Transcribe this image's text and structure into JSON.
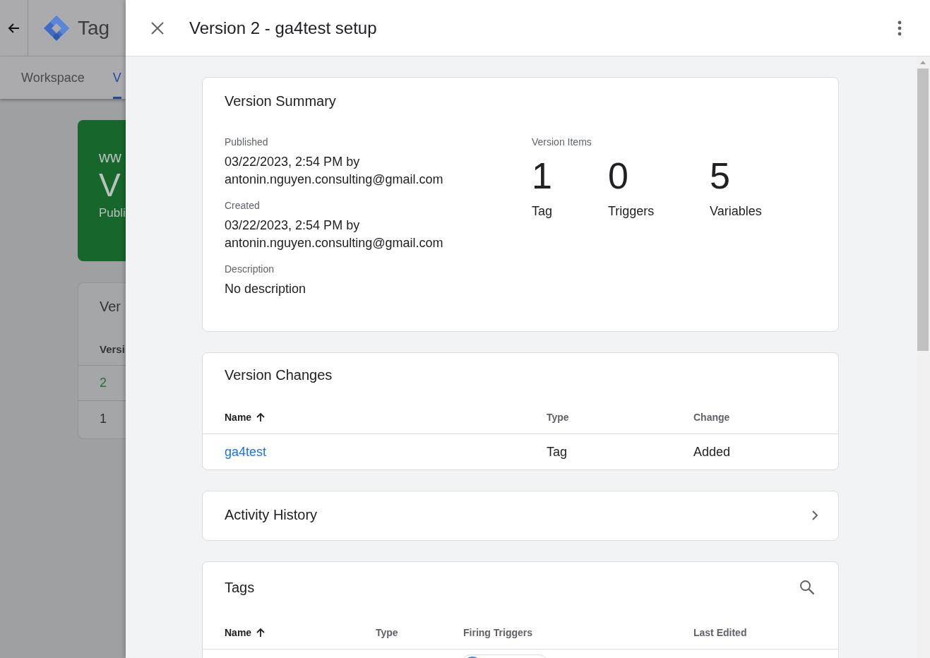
{
  "background": {
    "header": {
      "title": "Tag"
    },
    "tabs": [
      {
        "label": "Workspace",
        "selected": false
      },
      {
        "label": "V",
        "selected": true
      }
    ],
    "container_card": {
      "line_1": "ww",
      "line_2": "V",
      "line_3": "Publi"
    },
    "versions_card": {
      "title": "Ver",
      "column": "Versi",
      "rows": [
        {
          "version": "2",
          "live": true
        },
        {
          "version": "1",
          "live": false
        }
      ]
    }
  },
  "panel": {
    "title": "Version 2 - ga4test setup",
    "summary": {
      "title": "Version Summary",
      "fields": [
        {
          "label": "Published",
          "value": "03/22/2023, 2:54 PM by antonin.nguyen.consulting@gmail.com"
        },
        {
          "label": "Created",
          "value": "03/22/2023, 2:54 PM by antonin.nguyen.consulting@gmail.com"
        },
        {
          "label": "Description",
          "value": "No description"
        }
      ],
      "items_label": "Version Items",
      "items": [
        {
          "count": "1",
          "label": "Tag"
        },
        {
          "count": "0",
          "label": "Triggers"
        },
        {
          "count": "5",
          "label": "Variables"
        }
      ]
    },
    "changes": {
      "title": "Version Changes",
      "columns": [
        {
          "label": "Name",
          "sorted": true
        },
        {
          "label": "Type",
          "sorted": false
        },
        {
          "label": "Change",
          "sorted": false
        }
      ],
      "rows": [
        {
          "name": "ga4test",
          "type": "Tag",
          "change": "Added"
        }
      ]
    },
    "activity": {
      "title": "Activity History"
    },
    "tags": {
      "title": "Tags",
      "columns": [
        {
          "label": "Name",
          "sorted": true
        },
        {
          "label": "Type",
          "sorted": false
        },
        {
          "label": "Firing Triggers",
          "sorted": false
        },
        {
          "label": "Last Edited",
          "sorted": false
        }
      ]
    }
  }
}
